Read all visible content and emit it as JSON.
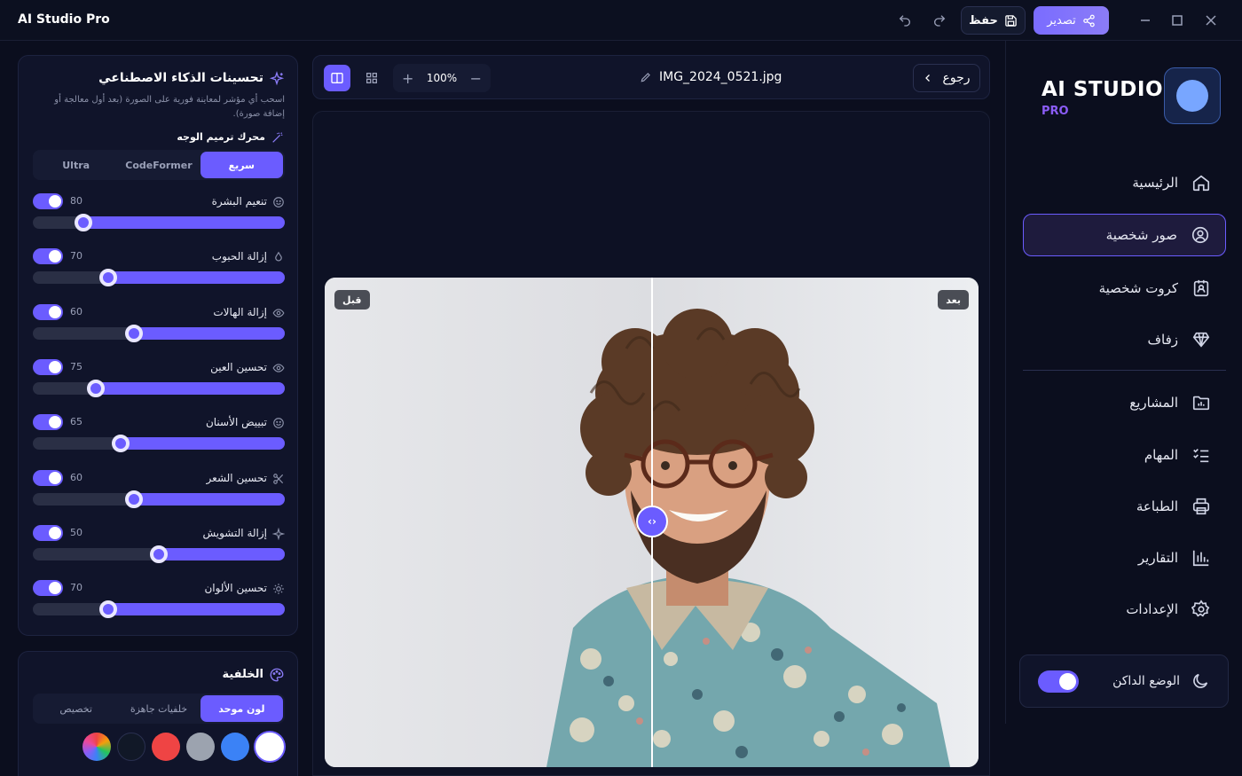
{
  "app": {
    "title": "AI Studio Pro"
  },
  "titlebar": {
    "save_label": "حفظ",
    "export_label": "تصدير"
  },
  "brand": {
    "name": "AI STUDIO",
    "badge": "PRO"
  },
  "nav": {
    "items": [
      {
        "label": "الرئيسية",
        "icon": "home-icon"
      },
      {
        "label": "صور شخصية",
        "icon": "user-circle-icon",
        "active": true
      },
      {
        "label": "كروت شخصية",
        "icon": "id-card-icon"
      },
      {
        "label": "زفاف",
        "icon": "diamond-icon"
      },
      {
        "label": "المشاريع",
        "icon": "folder-chart-icon"
      },
      {
        "label": "المهام",
        "icon": "checklist-icon"
      },
      {
        "label": "الطباعة",
        "icon": "printer-icon"
      },
      {
        "label": "التقارير",
        "icon": "bar-chart-icon"
      },
      {
        "label": "الإعدادات",
        "icon": "gear-icon"
      }
    ],
    "dark_mode_label": "الوضع الداكن"
  },
  "panel": {
    "title": "تحسينات الذكاء الاصطناعي",
    "description": "اسحب أي مؤشر لمعاينة فورية على الصورة (بعد أول معالجة أو إضافة صورة).",
    "engine_label": "محرك ترميم الوجه",
    "engine_options": [
      "سريع",
      "CodeFormer",
      "Ultra"
    ],
    "engine_selected": "سريع",
    "controls": [
      {
        "label": "تنعيم البشرة",
        "value": "80",
        "level": 0.8,
        "icon": "smile-icon"
      },
      {
        "label": "إزالة الحبوب",
        "value": "70",
        "level": 0.7,
        "icon": "droplet-icon"
      },
      {
        "label": "إزالة الهالات",
        "value": "60",
        "level": 0.6,
        "icon": "eye-icon"
      },
      {
        "label": "تحسين العين",
        "value": "75",
        "level": 0.75,
        "icon": "eye-icon"
      },
      {
        "label": "تبييض الأسنان",
        "value": "65",
        "level": 0.65,
        "icon": "smile-icon"
      },
      {
        "label": "تحسين الشعر",
        "value": "60",
        "level": 0.6,
        "icon": "scissors-icon"
      },
      {
        "label": "إزالة التشويش",
        "value": "50",
        "level": 0.5,
        "icon": "sparkle-icon"
      },
      {
        "label": "تحسين الألوان",
        "value": "70",
        "level": 0.7,
        "icon": "sun-icon"
      }
    ]
  },
  "background": {
    "title": "الخلفية",
    "tabs": [
      "لون موحد",
      "خلفيات جاهزة",
      "تخصيص"
    ],
    "tab_selected": "لون موحد",
    "swatches": [
      "#ffffff",
      "#3b82f6",
      "#9ca3af",
      "#ef4444",
      "#111827",
      "rainbow"
    ]
  },
  "toolbar": {
    "zoom": "100%",
    "filename": "IMG_2024_0521.jpg",
    "back_label": "رجوع"
  },
  "preview": {
    "before_label": "قبل",
    "after_label": "بعد"
  },
  "colors": {
    "accent": "#6b5cff",
    "bg": "#0b0e1e",
    "panel": "#10142a"
  }
}
